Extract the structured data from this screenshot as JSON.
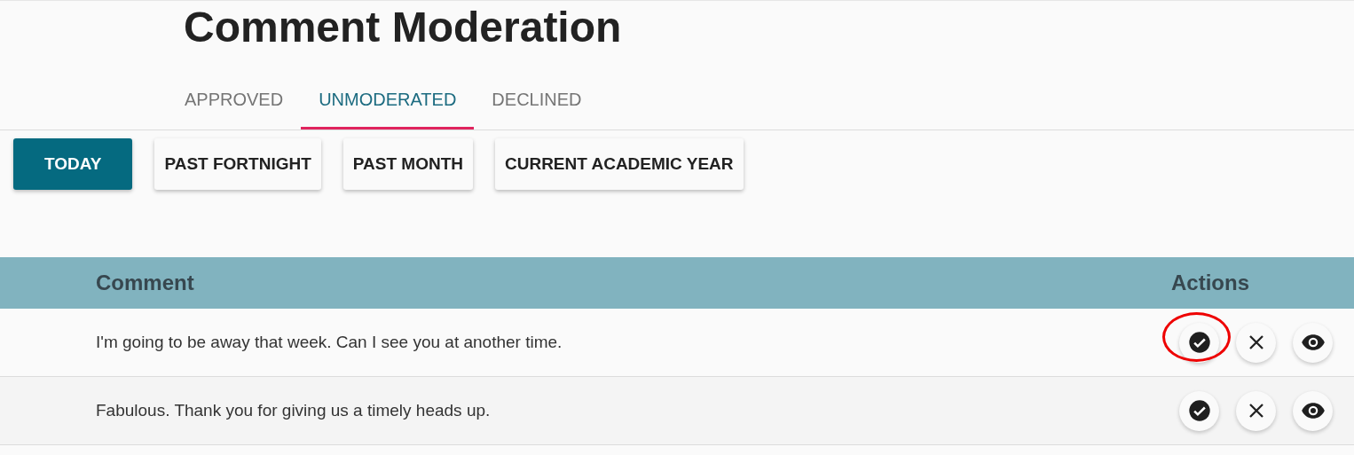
{
  "title": "Comment Moderation",
  "tabs": [
    {
      "label": "APPROVED",
      "selected": false
    },
    {
      "label": "UNMODERATED",
      "selected": true
    },
    {
      "label": "DECLINED",
      "selected": false
    }
  ],
  "filters": [
    {
      "label": "TODAY",
      "selected": true
    },
    {
      "label": "PAST FORTNIGHT",
      "selected": false
    },
    {
      "label": "PAST MONTH",
      "selected": false
    },
    {
      "label": "CURRENT ACADEMIC YEAR",
      "selected": false
    }
  ],
  "table": {
    "columns": [
      "Comment",
      "Actions"
    ],
    "rows": [
      {
        "comment": "I'm going to be away that week. Can I see you at another time.",
        "actions": [
          {
            "kind": "approve",
            "circled": true
          },
          {
            "kind": "decline",
            "circled": false
          },
          {
            "kind": "view",
            "circled": false
          }
        ]
      },
      {
        "comment": "Fabulous. Thank you for giving us a timely heads up.",
        "actions": [
          {
            "kind": "approve",
            "circled": false
          },
          {
            "kind": "decline",
            "circled": false
          },
          {
            "kind": "view",
            "circled": false
          }
        ]
      }
    ]
  }
}
